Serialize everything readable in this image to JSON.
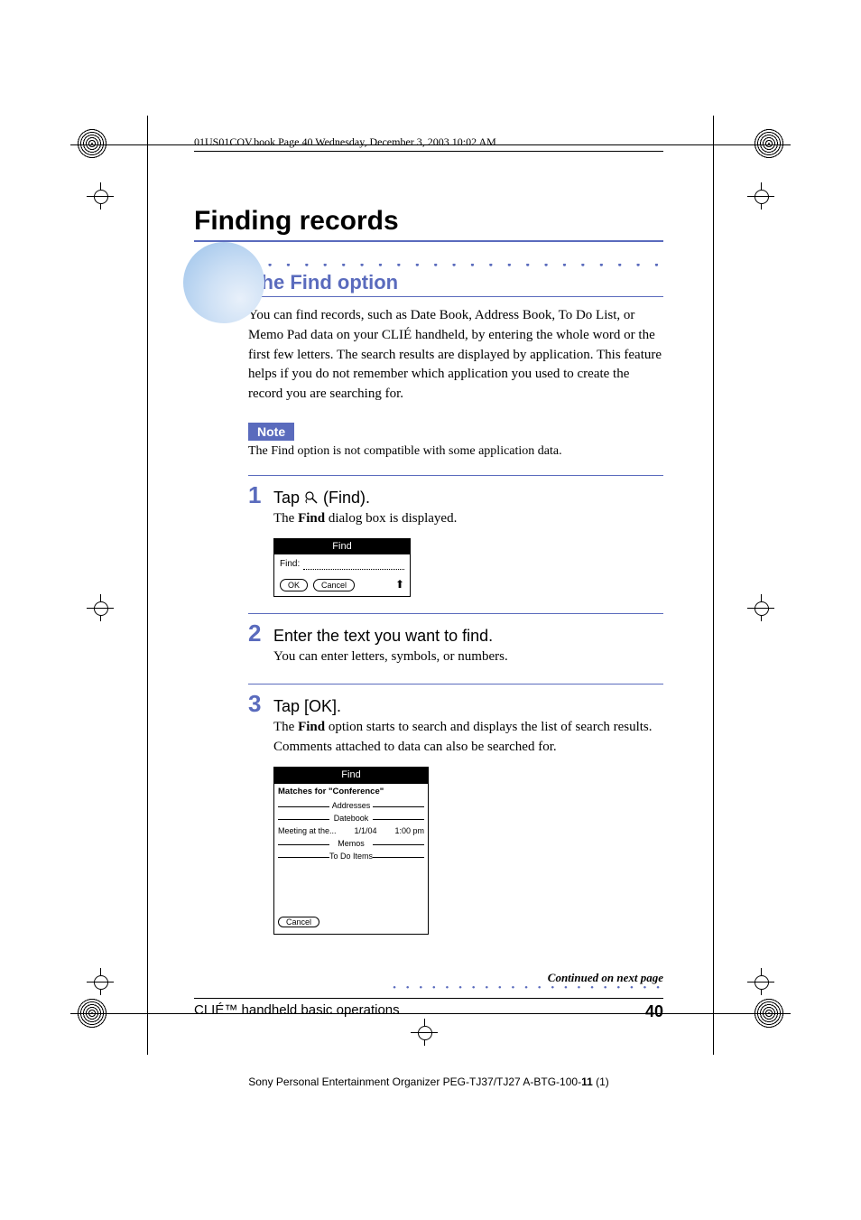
{
  "bookline": "01US01COV.book  Page 40  Wednesday, December 3, 2003  10:02 AM",
  "h1": "Finding records",
  "h2": "Using the Find option",
  "intro": "You can find records, such as Date Book, Address Book, To Do List, or Memo Pad data on your CLIÉ handheld, by entering the whole word or the first few letters. The search results are displayed by application. This feature helps if you do not remember which application you used to create the record you are searching for.",
  "note_label": "Note",
  "note_text": "The Find option is not compatible with some application data.",
  "steps": [
    {
      "num": "1",
      "title_pre": "Tap ",
      "title_post": " (Find).",
      "body_pre": "The ",
      "body_bold": "Find",
      "body_post": " dialog box is displayed."
    },
    {
      "num": "2",
      "title": "Enter the text you want to find.",
      "body": "You can enter letters, symbols, or numbers."
    },
    {
      "num": "3",
      "title": "Tap [OK].",
      "body_pre": "The ",
      "body_bold": "Find",
      "body_post": " option starts to search and displays the list of search results. Comments attached to data can also be searched for."
    }
  ],
  "dialog1": {
    "title": "Find",
    "label": "Find:",
    "ok": "OK",
    "cancel": "Cancel"
  },
  "dialog2": {
    "title": "Find",
    "matches": "Matches for \"Conference\"",
    "sections": [
      "Addresses",
      "Datebook",
      "Memos",
      "To Do Items"
    ],
    "row": {
      "c1": "Meeting at the...",
      "c2": "1/1/04",
      "c3": "1:00 pm"
    },
    "cancel": "Cancel"
  },
  "continued": "Continued on next page",
  "footer_left": "CLIÉ™ handheld basic operations",
  "footer_page": "40",
  "footer_bottom_pre": "Sony Personal Entertainment Organizer  PEG-TJ37/TJ27  A-BTG-100-",
  "footer_bottom_bold": "11",
  "footer_bottom_post": " (1)"
}
